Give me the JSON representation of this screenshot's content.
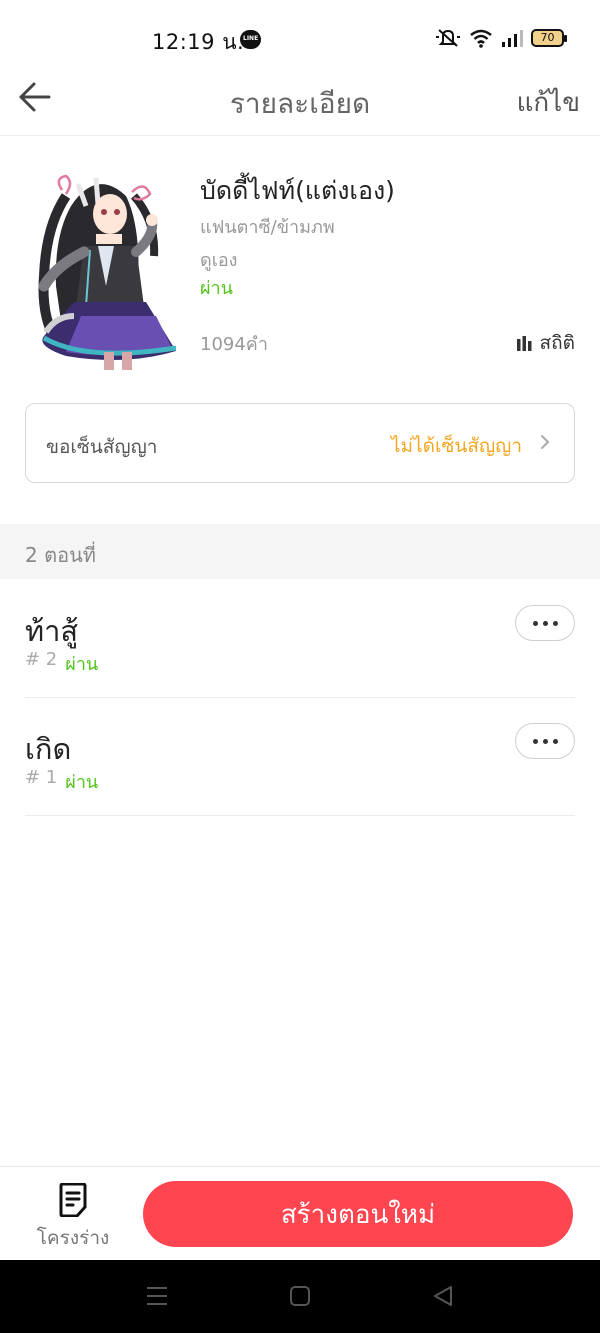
{
  "status_bar": {
    "time": "12:19 น.",
    "line_icon_text": "LINE",
    "battery": "70"
  },
  "header": {
    "title": "รายละเอียด",
    "edit_label": "แก้ไข"
  },
  "book": {
    "title": "บัดดี้ไฟท์(แต่งเอง)",
    "genre": "แฟนตาซี/ข้ามภพ",
    "author": "ดูเอง",
    "status": "ผ่าน",
    "word_count": "1094คำ",
    "stats_label": "สถิติ"
  },
  "contract": {
    "label": "ขอเซ็นสัญญา",
    "status": "ไม่ได้เซ็นสัญญา"
  },
  "chapters": {
    "section_label": "2 ตอนที่",
    "items": [
      {
        "title": "ท้าสู้",
        "number": "# 2",
        "status": "ผ่าน"
      },
      {
        "title": "เกิด",
        "number": "# 1",
        "status": "ผ่าน"
      }
    ]
  },
  "bottom": {
    "outline_label": "โครงร่าง",
    "create_label": "สร้างตอนใหม่"
  },
  "colors": {
    "accent": "#ff454f",
    "pass_green": "#52c41a",
    "contract_orange": "#f5a623"
  }
}
